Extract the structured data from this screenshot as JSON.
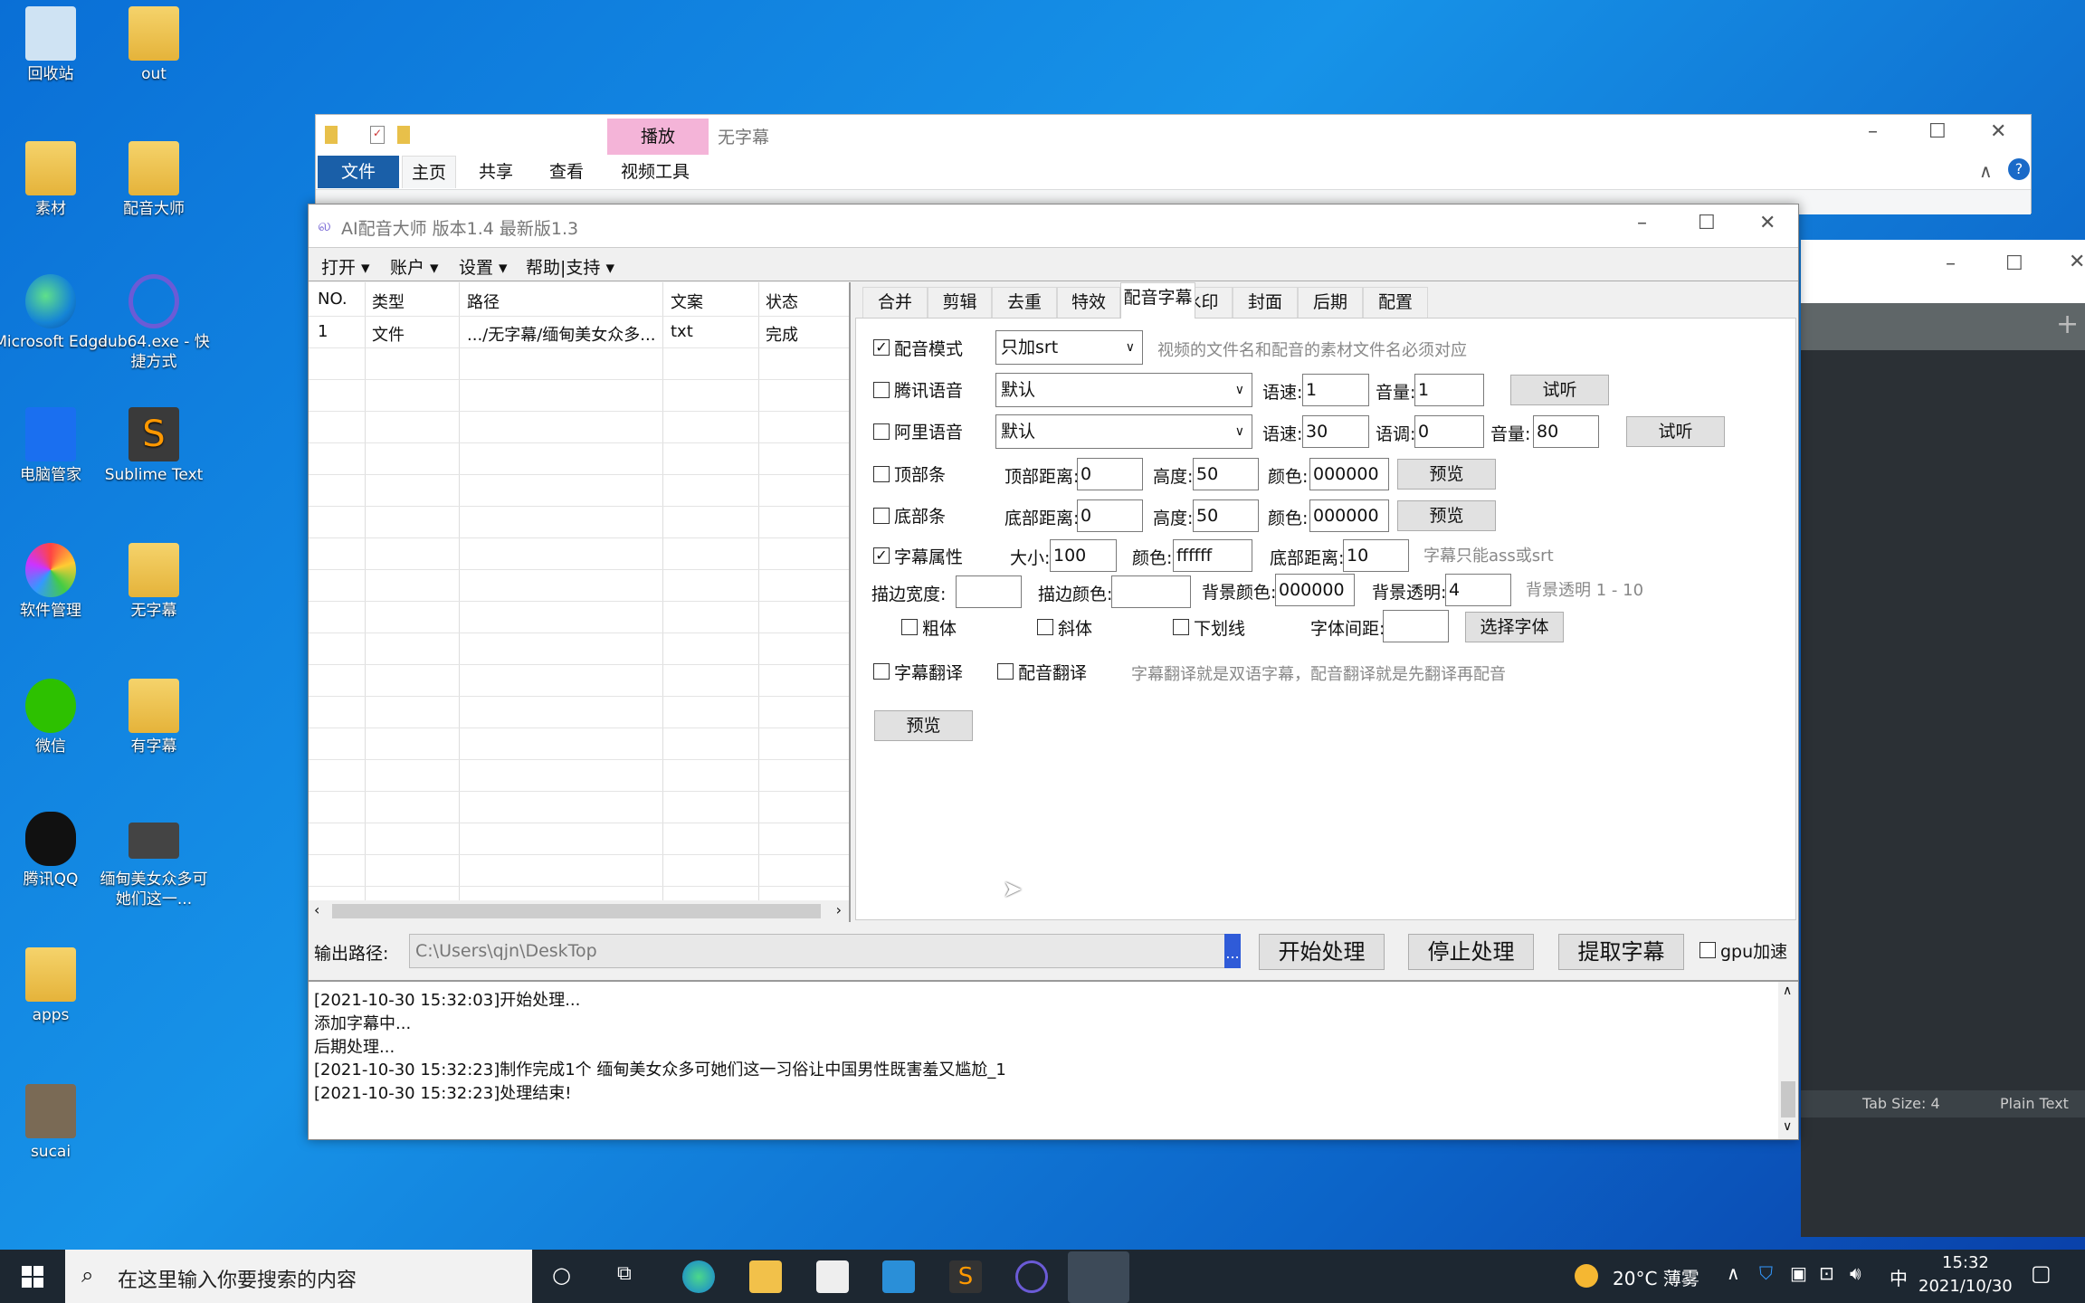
{
  "desktop": {
    "icons": [
      {
        "label": "回收站"
      },
      {
        "label": "out"
      },
      {
        "label": "素材"
      },
      {
        "label": "配音大师"
      },
      {
        "label": "Microsoft Edge"
      },
      {
        "label": "dub64.exe - 快捷方式"
      },
      {
        "label": "电脑管家"
      },
      {
        "label": "Sublime Text"
      },
      {
        "label": "软件管理"
      },
      {
        "label": "无字幕"
      },
      {
        "label": "微信"
      },
      {
        "label": "有字幕"
      },
      {
        "label": "腾讯QQ"
      },
      {
        "label": "缅甸美女众多可她们这一..."
      },
      {
        "label": "apps"
      },
      {
        "label": "sucai"
      }
    ]
  },
  "explorer": {
    "title": "无字幕",
    "context_tab": "播放",
    "tabs": [
      "文件",
      "主页",
      "共享",
      "查看",
      "视频工具"
    ],
    "minimize": "–",
    "maximize": "☐",
    "close": "✕",
    "collapse": "∧",
    "help": "?"
  },
  "sublime": {
    "status_tab": "Tab Size: 4",
    "status_syntax": "Plain Text",
    "new_tab": "+"
  },
  "app": {
    "title": "AI配音大师  版本1.4   最新版1.3",
    "menu": [
      "打开 ▾",
      "账户 ▾",
      "设置 ▾",
      "帮助|支持 ▾"
    ],
    "list": {
      "headers": [
        "NO.",
        "类型",
        "路径",
        "文案",
        "状态"
      ],
      "rows": [
        [
          "1",
          "文件",
          ".../无字幕/缅甸美女众多...",
          "txt",
          "完成"
        ]
      ]
    },
    "tabs": [
      "合并",
      "剪辑",
      "去重",
      "特效",
      "配音字幕",
      "水印",
      "封面",
      "后期",
      "配置"
    ],
    "selected_tab": "配音字幕",
    "form": {
      "dub_mode": {
        "label": "配音模式",
        "checked": true,
        "value": "只加srt",
        "hint": "视频的文件名和配音的素材文件名必须对应"
      },
      "tencent": {
        "label": "腾讯语音",
        "checked": false,
        "voice": "默认",
        "speed_label": "语速:",
        "speed": "1",
        "volume_label": "音量:",
        "volume": "1",
        "listen": "试听"
      },
      "ali": {
        "label": "阿里语音",
        "checked": false,
        "voice": "默认",
        "speed_label": "语速:",
        "speed": "30",
        "pitch_label": "语调:",
        "pitch": "0",
        "volume_label": "音量:",
        "volume": "80",
        "listen": "试听"
      },
      "top_bar": {
        "label": "顶部条",
        "checked": false,
        "dist_label": "顶部距离:",
        "dist": "0",
        "height_label": "高度:",
        "height": "50",
        "color_label": "颜色:",
        "color": "000000",
        "preview": "预览"
      },
      "bottom_bar": {
        "label": "底部条",
        "checked": false,
        "dist_label": "底部距离:",
        "dist": "0",
        "height_label": "高度:",
        "height": "50",
        "color_label": "颜色:",
        "color": "000000",
        "preview": "预览"
      },
      "subtitle": {
        "label": "字幕属性",
        "checked": true,
        "size_label": "大小:",
        "size": "100",
        "color_label": "颜色:",
        "color": "ffffff",
        "bottom_label": "底部距离:",
        "bottom": "10",
        "hint": "字幕只能ass或srt"
      },
      "stroke": {
        "width_label": "描边宽度:",
        "width": "",
        "color_label": "描边颜色:",
        "color": "",
        "bg_color_label": "背景颜色:",
        "bg_color": "000000",
        "bg_alpha_label": "背景透明:",
        "bg_alpha": "4",
        "hint": "背景透明 1 - 10"
      },
      "style": {
        "bold": "粗体",
        "italic": "斜体",
        "underline": "下划线",
        "spacing_label": "字体间距:",
        "spacing": "",
        "choose_font": "选择字体"
      },
      "translate": {
        "sub_label": "字幕翻译",
        "dub_label": "配音翻译",
        "hint": "字幕翻译就是双语字幕，配音翻译就是先翻译再配音"
      },
      "preview": "预览"
    },
    "output": {
      "label": "输出路径:",
      "path": "C:\\Users\\qjn\\DeskTop",
      "browse": "...",
      "start": "开始处理",
      "stop": "停止处理",
      "extract": "提取字幕",
      "gpu_label": "gpu加速",
      "gpu_checked": false
    },
    "log": [
      "[2021-10-30 15:32:03]开始处理...",
      "添加字幕中...",
      "后期处理...",
      "[2021-10-30 15:32:23]制作完成1个 缅甸美女众多可她们这一习俗让中国男性既害羞又尴尬_1",
      "[2021-10-30 15:32:23]处理结束!"
    ]
  },
  "taskbar": {
    "search_placeholder": "在这里输入你要搜索的内容",
    "weather": "20°C 薄雾",
    "ime": "中",
    "time": "15:32",
    "date": "2021/10/30"
  }
}
